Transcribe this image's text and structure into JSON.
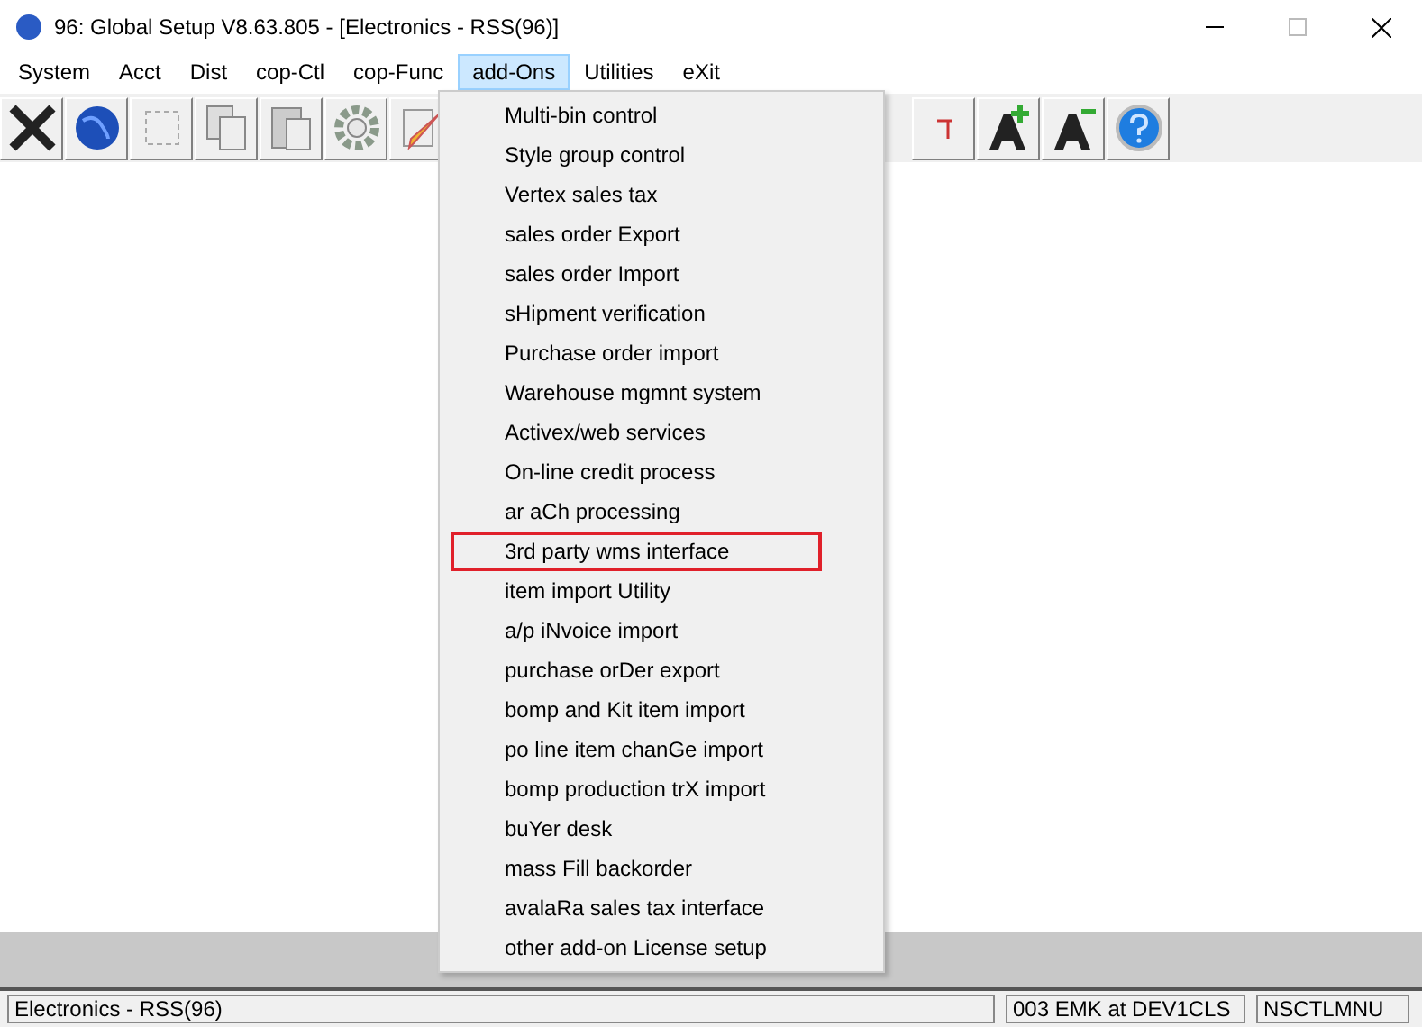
{
  "window": {
    "title": "96: Global Setup V8.63.805 - [Electronics - RSS(96)]"
  },
  "menu_bar": [
    {
      "label": "System",
      "selected": false
    },
    {
      "label": "Acct",
      "selected": false
    },
    {
      "label": "Dist",
      "selected": false
    },
    {
      "label": "cop-Ctl",
      "selected": false
    },
    {
      "label": "cop-Func",
      "selected": false
    },
    {
      "label": "add-Ons",
      "selected": true
    },
    {
      "label": "Utilities",
      "selected": false
    },
    {
      "label": "eXit",
      "selected": false
    }
  ],
  "dropdown": [
    {
      "label": "Multi-bin control",
      "highlighted": false
    },
    {
      "label": "Style group control",
      "highlighted": false
    },
    {
      "label": "Vertex sales tax",
      "highlighted": false
    },
    {
      "label": "sales order Export",
      "highlighted": false
    },
    {
      "label": "sales order Import",
      "highlighted": false
    },
    {
      "label": "sHipment verification",
      "highlighted": false
    },
    {
      "label": "Purchase order import",
      "highlighted": false
    },
    {
      "label": "Warehouse mgmnt system",
      "highlighted": false
    },
    {
      "label": "Activex/web services",
      "highlighted": false
    },
    {
      "label": "On-line credit process",
      "highlighted": false
    },
    {
      "label": "ar aCh processing",
      "highlighted": false
    },
    {
      "label": "3rd party wms interface",
      "highlighted": true
    },
    {
      "label": "item import Utility",
      "highlighted": false
    },
    {
      "label": "a/p iNvoice import",
      "highlighted": false
    },
    {
      "label": "purchase orDer export",
      "highlighted": false
    },
    {
      "label": "bomp and Kit item import",
      "highlighted": false
    },
    {
      "label": "po line item chanGe import",
      "highlighted": false
    },
    {
      "label": "bomp production trX import",
      "highlighted": false
    },
    {
      "label": "buYer desk",
      "highlighted": false
    },
    {
      "label": "mass Fill backorder",
      "highlighted": false
    },
    {
      "label": "avalaRa sales tax interface",
      "highlighted": false
    },
    {
      "label": "other add-on License setup",
      "highlighted": false
    }
  ],
  "status_bar": [
    "Electronics - RSS(96)",
    "003 EMK at DEV1CLS",
    "NSCTLMNU"
  ]
}
